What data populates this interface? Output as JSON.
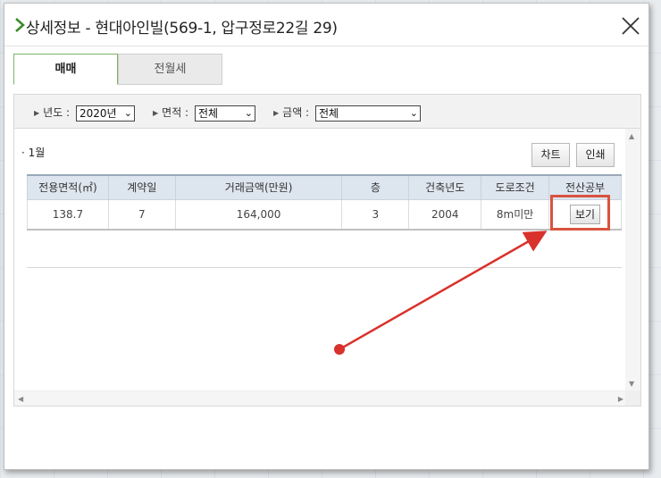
{
  "dialog": {
    "title": "상세정보 - 현대아인빌(569-1, 압구정로22길 29)"
  },
  "tabs": [
    {
      "label": "매매",
      "active": true
    },
    {
      "label": "전월세",
      "active": false
    }
  ],
  "filters": {
    "year": {
      "label": "년도 :",
      "value": "2020년"
    },
    "area": {
      "label": "면적 :",
      "value": "전체"
    },
    "price": {
      "label": "금액 :",
      "value": "전체"
    }
  },
  "content": {
    "month_label": "· 1월",
    "chart_button": "차트",
    "print_button": "인쇄",
    "table": {
      "headers": [
        "전용면적(㎡)",
        "계약일",
        "거래금액(만원)",
        "층",
        "건축년도",
        "도로조건",
        "전산공부"
      ],
      "rows": [
        {
          "area": "138.7",
          "day": "7",
          "price": "164,000",
          "floor": "3",
          "built": "2004",
          "road": "8m미만",
          "view": "보기"
        }
      ]
    }
  },
  "colors": {
    "accent_green": "#3a8a2a",
    "annotation_red": "#d9533f",
    "header_bg": "#dde5ef"
  },
  "icons": {
    "title": "chevron-right-icon",
    "close": "close-icon"
  }
}
